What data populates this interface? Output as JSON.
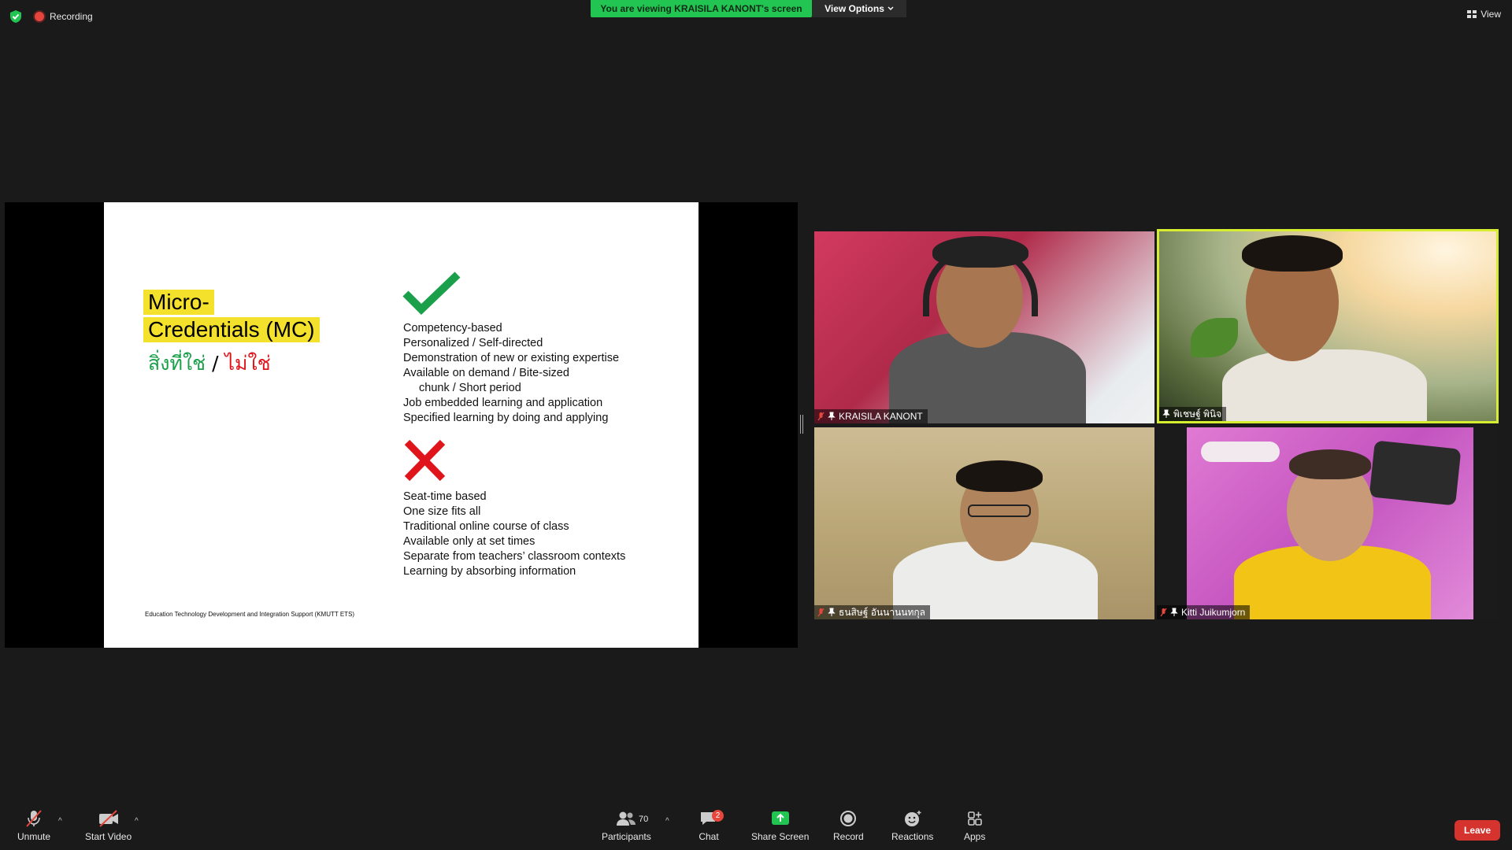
{
  "topbar": {
    "recording_label": "Recording",
    "viewing_banner": "You are viewing KRAISILA KANONT's screen",
    "view_options_label": "View Options",
    "view_label": "View",
    "banner_color": "#23c552"
  },
  "slide": {
    "title_line1": "Micro-",
    "title_line2": "Credentials (MC)",
    "thai_yes": "สิ่งที่ใช่",
    "thai_sep": "/",
    "thai_no": "ไม่ใช่",
    "is_items": [
      "Competency-based",
      "Personalized / Self-directed",
      "Demonstration of new or existing expertise",
      "Available on demand / Bite-sized",
      "chunk / Short period",
      "Job embedded learning and application",
      "Specified learning by doing and applying"
    ],
    "is_not_items": [
      "Seat-time based",
      "One size fits all",
      "Traditional online course of class",
      "Available only at set times",
      "Separate from teachers’ classroom contexts",
      "Learning by absorbing information"
    ],
    "footer": "Education Technology Development and Integration Support (KMUTT ETS)",
    "highlight_color": "#f3e12b",
    "check_color": "#1aa04a",
    "cross_color": "#e0151b"
  },
  "participants_video": [
    {
      "name": "KRAISILA KANONT",
      "muted": true,
      "pinned": true
    },
    {
      "name": "พิเชษฐ์ พินิจ",
      "muted": false,
      "pinned": true,
      "active_speaker": true
    },
    {
      "name": "ธนสิษฐ์ อันนานนทกุล",
      "muted": true,
      "pinned": true
    },
    {
      "name": "Kitti Juikumjorn",
      "muted": true,
      "pinned": true
    }
  ],
  "toolbar": {
    "unmute": "Unmute",
    "start_video": "Start Video",
    "participants": "Participants",
    "participants_count": "70",
    "chat": "Chat",
    "chat_badge": "2",
    "share_screen": "Share Screen",
    "record": "Record",
    "reactions": "Reactions",
    "apps": "Apps",
    "leave": "Leave",
    "leave_color": "#d5342e",
    "share_color": "#23c552"
  }
}
